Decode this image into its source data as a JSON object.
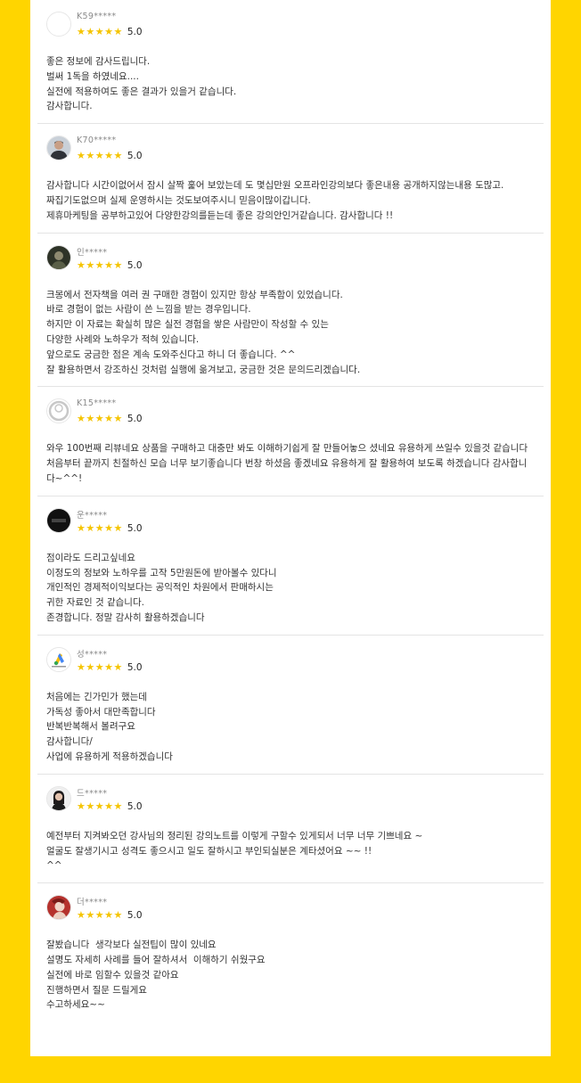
{
  "colors": {
    "background": "#ffd500",
    "panel": "#ffffff",
    "star": "#f5c400",
    "text": "#333333",
    "name": "#8a8a8a"
  },
  "reviews": [
    {
      "name": "K59*****",
      "avatar": "blank-avatar",
      "stars": "★★★★★",
      "score": "5.0",
      "text": "좋은 정보에 감사드립니다.\n벌써 1독을 하였네요....\n실전에 적용하여도 좋은 결과가 있을거 같습니다.\n감사합니다."
    },
    {
      "name": "K70*****",
      "avatar": "man-photo-avatar",
      "stars": "★★★★★",
      "score": "5.0",
      "text": "감사합니다 시간이없어서 잠시 살짝 훑어 보았는데 도 몇십만원 오프라인강의보다 좋은내용 공개하지않는내용 도많고.\n짜집기도없으며 실제 운영하시는 것도보여주시니 믿음이많이갑니다.\n제휴마케팅을 공부하고있어 다양한강의를듣는데 좋은 강의안인거같습니다. 감사합니다 !!"
    },
    {
      "name": "인*****",
      "avatar": "dark-photo-avatar",
      "stars": "★★★★★",
      "score": "5.0",
      "text": "크몽에서 전자책을 여러 권 구매한 경험이 있지만 항상 부족함이 있었습니다.\n바로 경험이 없는 사람이 쓴 느낌을 받는 경우입니다.\n하지만 이 자료는 확실히 많은 실전 경험을 쌓은 사람만이 작성할 수 있는\n다양한 사례와 노하우가 적혀 있습니다.\n앞으로도 궁금한 점은 계속 도와주신다고 하니 더 좋습니다. ^^\n잘 활용하면서 강조하신 것처럼 실행에 옮겨보고, 궁금한 것은 문의드리겠습니다."
    },
    {
      "name": "K15*****",
      "avatar": "default-user-avatar",
      "stars": "★★★★★",
      "score": "5.0",
      "text": "와우 100번째 리뷰네요 상품을 구매하고 대충만 봐도 이해하기쉽게 잘 만들어놓으 셨네요 유용하게 쓰일수 있을것 같습니다 처음부터 끝까지 친절하신 모습 너무 보기좋습니다 번창 하셨음 좋겠네요 유용하게 잘 활용하여 보도록 하겠습니다 감사합니다~^^!"
    },
    {
      "name": "운*****",
      "avatar": "black-logo-avatar",
      "logo_text": "HOUSE PLANS",
      "stars": "★★★★★",
      "score": "5.0",
      "text": "점이라도 드리고싶네요\n이정도의 정보와 노하우를 고작 5만원돈에 받아볼수 있다니\n개인적인 경제적이익보다는 공익적인 차원에서 판매하시는\n귀한 자료인 것 같습니다.\n존경합니다. 정말 감사히 활용하겠습니다"
    },
    {
      "name": "성*****",
      "avatar": "google-adsense-avatar",
      "logo_text": "Google AdSense",
      "stars": "★★★★★",
      "score": "5.0",
      "text": "처음에는 긴가민가 했는데\n가독성 좋아서 대만족합니다\n반복반복해서 볼려구요\n감사합니다/\n사업에 유용하게 적용하겠습니다"
    },
    {
      "name": "드*****",
      "avatar": "woman-photo-avatar",
      "stars": "★★★★★",
      "score": "5.0",
      "text": "예전부터 지켜봐오던 강사님의 정리된 강의노트를 이렇게 구할수 있게되서 너무 너무 기쁘네요 ~\n얼굴도 잘생기시고 성격도 좋으시고 일도 잘하시고 부인되실분은 계타셨어요 ~~ !!\n^^"
    },
    {
      "name": "더*****",
      "avatar": "red-photo-avatar",
      "stars": "★★★★★",
      "score": "5.0",
      "text": "잘봤습니다  생각보다 실전팁이 많이 있네요\n설명도 자세히 사례를 들어 잘하셔서  이해하기 쉬웠구요\n실전에 바로 임할수 있을것 같아요\n진행하면서 질문 드릴게요\n수고하세요~~"
    }
  ]
}
